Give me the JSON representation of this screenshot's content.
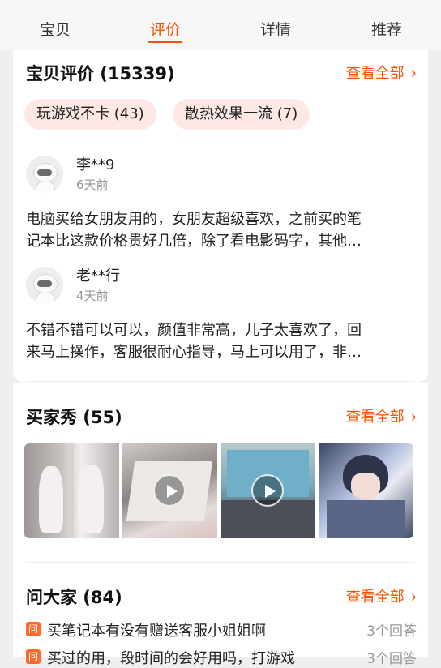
{
  "tabs": [
    {
      "label": "宝贝"
    },
    {
      "label": "评价"
    },
    {
      "label": "详情"
    },
    {
      "label": "推荐"
    }
  ],
  "active_tab": "评价",
  "reviews_section": {
    "title": "宝贝评价 (15339)",
    "see_all": "查看全部",
    "tags": [
      "玩游戏不卡 (43)",
      "散热效果一流 (7)"
    ],
    "items": [
      {
        "user": "李**9",
        "time": "6天前",
        "lines": [
          "电脑买给女朋友用的，女朋友超级喜欢，之前买的笔",
          "记本比这款价格贵好几倍，除了看电影码字，其他…"
        ]
      },
      {
        "user": "老**行",
        "time": "4天前",
        "lines": [
          "不错不错可以可以，颜值非常高，儿子太喜欢了，回",
          "来马上操作，客服很耐心指导，马上可以用了，非…"
        ]
      }
    ]
  },
  "buyer_show": {
    "title": "买家秀 (55)",
    "see_all": "查看全部"
  },
  "ask_all": {
    "title": "问大家 (84)",
    "see_all": "查看全部",
    "icon_label": "问",
    "questions": [
      {
        "text": "买笔记本有没有赠送客服小姐姐啊",
        "count": "3个回答"
      },
      {
        "text": "买过的用，段时间的会好用吗，打游戏",
        "count": "3个回答"
      }
    ]
  },
  "colors": {
    "accent": "#ff5000",
    "chip_bg": "#fde8e6"
  }
}
